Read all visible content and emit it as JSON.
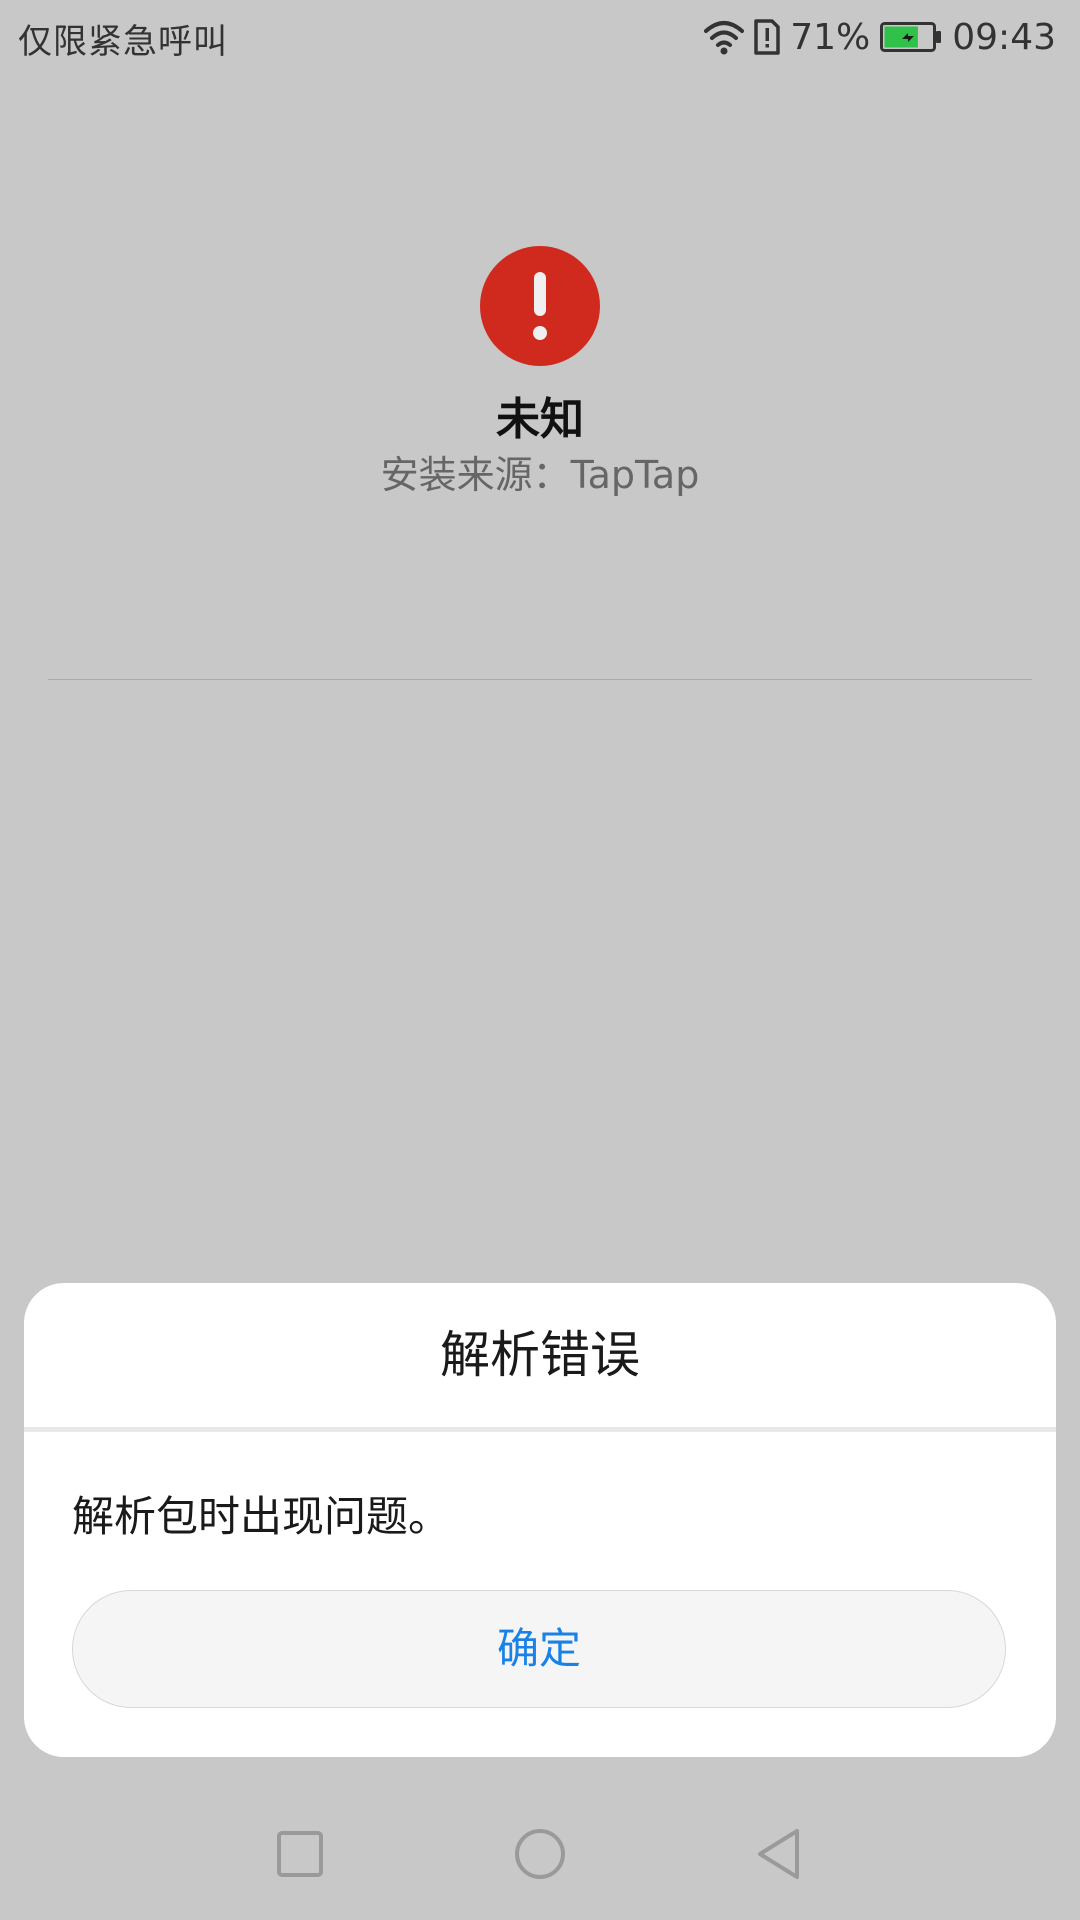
{
  "status_bar": {
    "carrier_text": "仅限紧急呼叫",
    "battery_percent": "71%",
    "time": "09:43",
    "icons": [
      "wifi-icon",
      "sim-alert-icon",
      "battery-charging-icon"
    ],
    "battery_level": 0.71,
    "battery_color": "#2fc14a"
  },
  "app_info": {
    "name": "未知",
    "source_label": "安装来源：",
    "source_value": "TapTap",
    "icon": "error-exclamation-icon",
    "icon_color": "#d02a1e"
  },
  "dialog": {
    "title": "解析错误",
    "message": "解析包时出现问题。",
    "confirm_label": "确定",
    "accent_color": "#1a82e6"
  },
  "nav_bar": {
    "icons": [
      "recents-square-icon",
      "home-circle-icon",
      "back-triangle-icon"
    ]
  }
}
